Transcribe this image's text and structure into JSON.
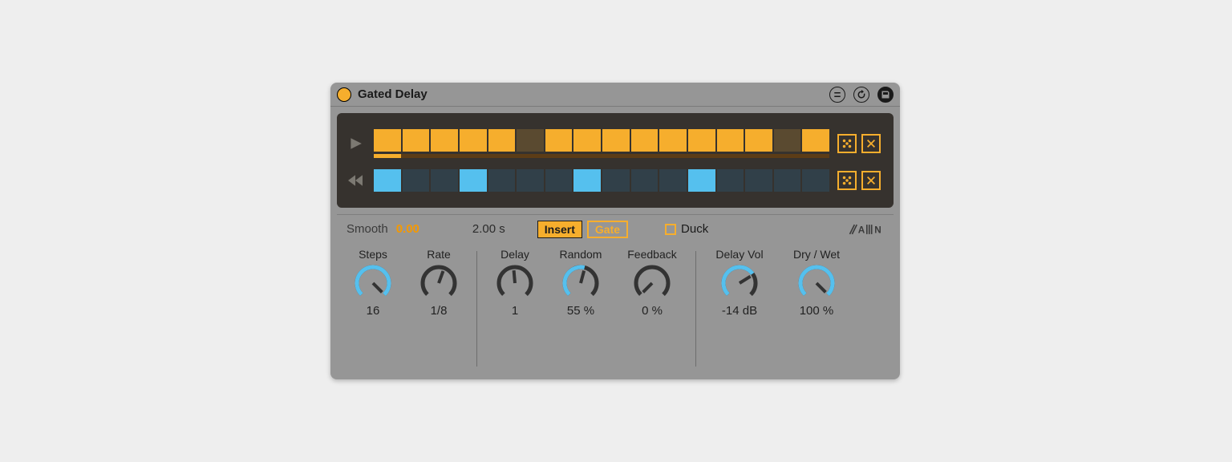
{
  "title": "Gated Delay",
  "sequencer": {
    "forward_lane": [
      1,
      1,
      1,
      1,
      1,
      0,
      1,
      1,
      1,
      1,
      1,
      1,
      1,
      1,
      0,
      1
    ],
    "reverse_lane": [
      1,
      0,
      0,
      1,
      0,
      0,
      0,
      1,
      0,
      0,
      0,
      1,
      0,
      0,
      0,
      0
    ],
    "progress_pct": 6
  },
  "strip": {
    "smooth_label": "Smooth",
    "smooth_value": "0.00",
    "time_value": "2.00 s",
    "insert_label": "Insert",
    "gate_label": "Gate",
    "duck_label": "Duck"
  },
  "knobs": [
    {
      "label": "Steps",
      "value": "16",
      "arc_pct": 100,
      "pointer_deg": 135,
      "color": "blue"
    },
    {
      "label": "Rate",
      "value": "1/8",
      "arc_pct": 0,
      "pointer_deg": 20,
      "color": "blue"
    },
    {
      "label": "Delay",
      "value": "1",
      "arc_pct": 0,
      "pointer_deg": -5,
      "color": "blue"
    },
    {
      "label": "Random",
      "value": "55 %",
      "arc_pct": 55,
      "pointer_deg": 15,
      "color": "blue"
    },
    {
      "label": "Feedback",
      "value": "0 %",
      "arc_pct": 0,
      "pointer_deg": -135,
      "color": "dark"
    },
    {
      "label": "Delay Vol",
      "value": "-14 dB",
      "arc_pct": 70,
      "pointer_deg": 58,
      "color": "blue"
    },
    {
      "label": "Dry / Wet",
      "value": "100 %",
      "arc_pct": 100,
      "pointer_deg": 135,
      "color": "blue"
    }
  ]
}
